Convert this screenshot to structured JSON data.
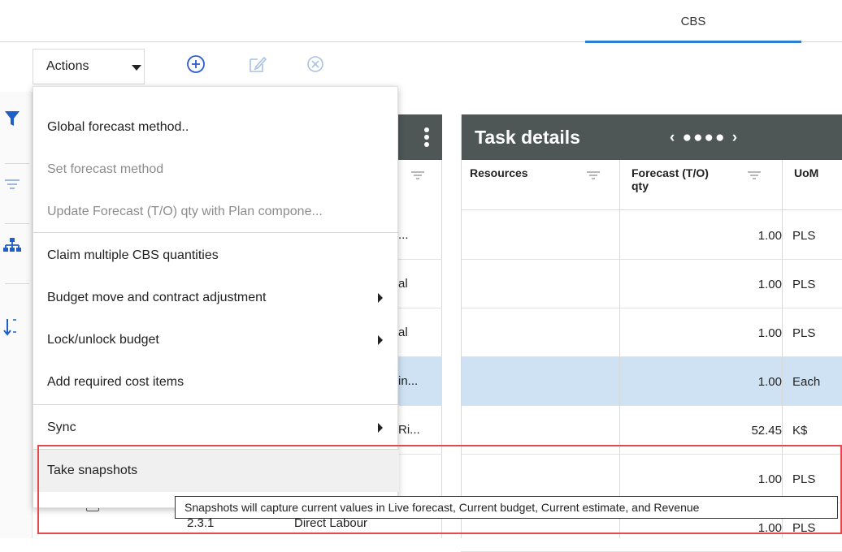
{
  "tabs": {
    "cbs": "CBS"
  },
  "toolbar": {
    "actions_label": "Actions",
    "icons": [
      "add-circle-icon",
      "edit-icon",
      "cancel-circle-icon"
    ]
  },
  "left_strip": {
    "icons": [
      "filter-icon",
      "filter-lines-icon",
      "hierarchy-icon",
      "sort-az-icon"
    ]
  },
  "middle_column": {
    "cells": [
      "...",
      "al",
      "al",
      "in...",
      "Ri...",
      ""
    ]
  },
  "task_details": {
    "title": "Task details",
    "nav": "‹ ●●●● ›",
    "columns": [
      "Resources",
      "Forecast (T/O) qty",
      "UoM"
    ],
    "rows": [
      {
        "resources": "",
        "forecast_qty": "1.00",
        "uom": "PLS",
        "selected": false
      },
      {
        "resources": "",
        "forecast_qty": "1.00",
        "uom": "PLS",
        "selected": false
      },
      {
        "resources": "",
        "forecast_qty": "1.00",
        "uom": "PLS",
        "selected": false
      },
      {
        "resources": "",
        "forecast_qty": "1.00",
        "uom": "Each",
        "selected": true
      },
      {
        "resources": "",
        "forecast_qty": "52.45",
        "uom": "K$",
        "selected": false
      },
      {
        "resources": "",
        "forecast_qty": "1.00",
        "uom": "PLS",
        "selected": false
      },
      {
        "resources": "",
        "forecast_qty": "1.00",
        "uom": "PLS",
        "selected": false
      }
    ]
  },
  "bottom_row": {
    "code": "2.3.1",
    "name": "Direct Labour"
  },
  "menu": {
    "items": [
      {
        "label": "Global forecast method..",
        "disabled": false,
        "submenu": false
      },
      {
        "label": "Set forecast method",
        "disabled": true,
        "submenu": false
      },
      {
        "label": "Update Forecast (T/O) qty with Plan compone...",
        "disabled": true,
        "submenu": false
      },
      {
        "label": "Claim multiple CBS quantities",
        "disabled": false,
        "submenu": false
      },
      {
        "label": "Budget move and contract adjustment",
        "disabled": false,
        "submenu": true
      },
      {
        "label": "Lock/unlock budget",
        "disabled": false,
        "submenu": true
      },
      {
        "label": "Add required cost items",
        "disabled": false,
        "submenu": false
      },
      {
        "label": "Sync",
        "disabled": false,
        "submenu": true
      },
      {
        "label": "Take snapshots",
        "disabled": false,
        "submenu": false,
        "hovered": true
      }
    ]
  },
  "tooltip": {
    "text": "Snapshots will capture current values in Live forecast, Current budget, Current estimate, and Revenue"
  },
  "colors": {
    "accent": "#2d7fd3",
    "header_bg": "#4e5756",
    "selected_row": "#cfe2f3",
    "highlight": "#e4494d"
  }
}
